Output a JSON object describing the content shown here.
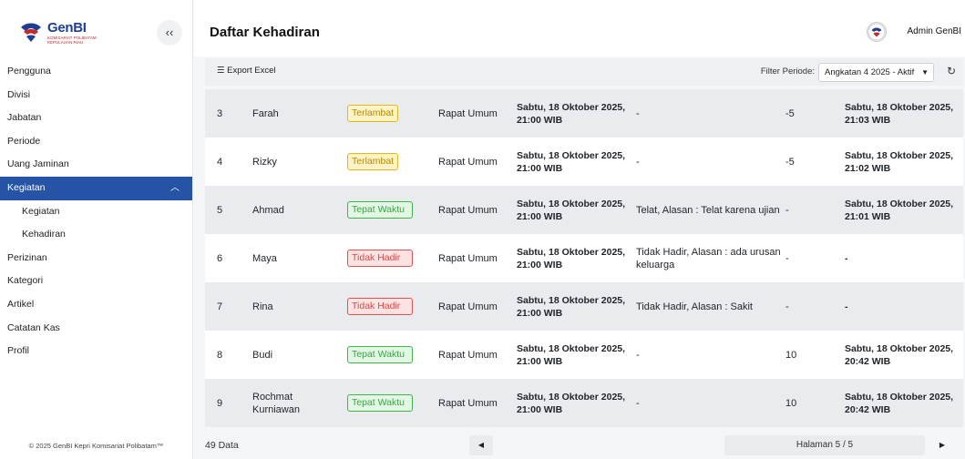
{
  "brand": {
    "name": "GenBI",
    "tagline": "KOMISARIAT POLIBATAM KEPULAUAN RIAU"
  },
  "sidebar": {
    "collapse_label": "‹‹",
    "items": [
      {
        "label": "Pengguna",
        "active": false,
        "sub": false
      },
      {
        "label": "Divisi",
        "active": false,
        "sub": false
      },
      {
        "label": "Jabatan",
        "active": false,
        "sub": false
      },
      {
        "label": "Periode",
        "active": false,
        "sub": false
      },
      {
        "label": "Uang Jaminan",
        "active": false,
        "sub": false
      },
      {
        "label": "Kegiatan",
        "active": true,
        "sub": false
      },
      {
        "label": "Kegiatan",
        "active": false,
        "sub": true
      },
      {
        "label": "Kehadiran",
        "active": false,
        "sub": true
      },
      {
        "label": "Perizinan",
        "active": false,
        "sub": false
      },
      {
        "label": "Kategori",
        "active": false,
        "sub": false
      },
      {
        "label": "Artikel",
        "active": false,
        "sub": false
      },
      {
        "label": "Catatan Kas",
        "active": false,
        "sub": false
      },
      {
        "label": "Profil",
        "active": false,
        "sub": false
      }
    ],
    "footer": "© 2025 GenBI Kepri Komisariat Polibatam™"
  },
  "header": {
    "title": "Daftar Kehadiran",
    "user": "Admin GenBI"
  },
  "toolbar": {
    "export_label": "☰ Export Excel",
    "filter_label": "Filter Periode:",
    "filter_value": "Angkatan 4 2025 - Aktif",
    "refresh_icon": "↻"
  },
  "table": {
    "rows": [
      {
        "no": "3",
        "name": "Farah",
        "status": "Terlambat",
        "status_type": "late",
        "type": "Rapat Umum",
        "date": "Sabtu, 18 Oktober 2025, 21:00 WIB",
        "note": "-",
        "score": "-5",
        "time": "Sabtu, 18 Oktober 2025, 21:03 WIB"
      },
      {
        "no": "4",
        "name": "Rizky",
        "status": "Terlambat",
        "status_type": "late",
        "type": "Rapat Umum",
        "date": "Sabtu, 18 Oktober 2025, 21:00 WIB",
        "note": "-",
        "score": "-5",
        "time": "Sabtu, 18 Oktober 2025, 21:02 WIB"
      },
      {
        "no": "5",
        "name": "Ahmad",
        "status": "Tepat Waktu",
        "status_type": "ontime",
        "type": "Rapat Umum",
        "date": "Sabtu, 18 Oktober 2025, 21:00 WIB",
        "note": "Telat, Alasan : Telat karena ujian",
        "score": "-",
        "time": "Sabtu, 18 Oktober 2025, 21:01 WIB"
      },
      {
        "no": "6",
        "name": "Maya",
        "status": "Tidak Hadir",
        "status_type": "absent",
        "type": "Rapat Umum",
        "date": "Sabtu, 18 Oktober 2025, 21:00 WIB",
        "note": "Tidak Hadir, Alasan : ada urusan keluarga",
        "score": "-",
        "time": "-"
      },
      {
        "no": "7",
        "name": "Rina",
        "status": "Tidak Hadir",
        "status_type": "absent",
        "type": "Rapat Umum",
        "date": "Sabtu, 18 Oktober 2025, 21:00 WIB",
        "note": "Tidak Hadir, Alasan : Sakit",
        "score": "-",
        "time": "-"
      },
      {
        "no": "8",
        "name": "Budi",
        "status": "Tepat Waktu",
        "status_type": "ontime",
        "type": "Rapat Umum",
        "date": "Sabtu, 18 Oktober 2025, 21:00 WIB",
        "note": "-",
        "score": "10",
        "time": "Sabtu, 18 Oktober 2025, 20:42 WIB"
      },
      {
        "no": "9",
        "name": "Rochmat Kurniawan",
        "status": "Tepat Waktu",
        "status_type": "ontime",
        "type": "Rapat Umum",
        "date": "Sabtu, 18 Oktober 2025, 21:00 WIB",
        "note": "-",
        "score": "10",
        "time": "Sabtu, 18 Oktober 2025, 20:42 WIB"
      }
    ]
  },
  "pagination": {
    "count": "49 Data",
    "page_label": "Halaman 5 / 5",
    "prev_icon": "◀",
    "next_icon": "▶"
  },
  "colors": {
    "accent": "#2653a6",
    "late": "#e6b81a",
    "ontime": "#3fb54a",
    "absent": "#e05151"
  }
}
